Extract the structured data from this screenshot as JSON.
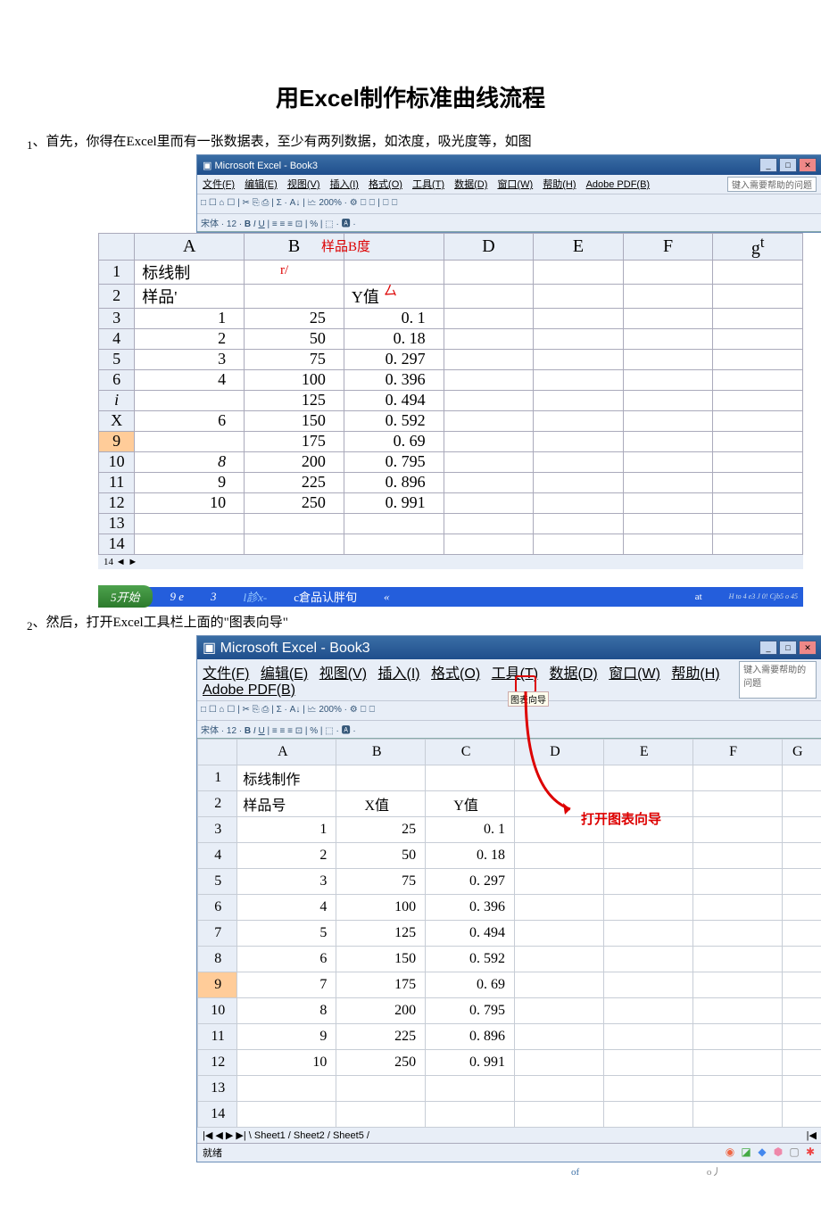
{
  "title": "用Excel制作标准曲线流程",
  "step1": {
    "num": "1",
    "text": "、首先，你得在Excel里而有一张数据表，至少有两列数据，如浓度，吸光度等，如图"
  },
  "step2": {
    "num": "2",
    "text": "、然后，打开Excel工具栏上面的\"图表向导\""
  },
  "excel_window": {
    "title": "Microsoft Excel - Book3",
    "menus": [
      "文件(F)",
      "编辑(E)",
      "视图(V)",
      "插入(I)",
      "格式(O)",
      "工具(T)",
      "数据(D)",
      "窗口(W)",
      "帮助(H)",
      "Adobe PDF(B)"
    ],
    "help_placeholder": "键入需要帮助的问题",
    "win_subtitle": "- _ ☐ ✕",
    "font_label": "宋体",
    "font_size": "12",
    "zoom": "200%",
    "chart_wizard_tooltip": "图表向导"
  },
  "sheet1": {
    "col_headers": [
      "A",
      "B",
      "D",
      "E",
      "F"
    ],
    "g_sup": "g",
    "g_sup_t": "t",
    "red_overlay1": "样品B度",
    "red_overlay2": "r/",
    "red_overlay3": "厶",
    "row_headers": [
      "1",
      "2",
      "3",
      "4",
      "5",
      "6",
      "i",
      "X",
      "9",
      "10",
      "11",
      "12",
      "13",
      "14"
    ],
    "r1": "标线制",
    "r2a": "样品'",
    "r2c": "Y值",
    "data": [
      {
        "a": "1",
        "b": "25",
        "c": "0. 1"
      },
      {
        "a": "2",
        "b": "50",
        "c": "0. 18"
      },
      {
        "a": "3",
        "b": "75",
        "c": "0. 297"
      },
      {
        "a": "4",
        "b": "100",
        "c": "0. 396"
      },
      {
        "a": "",
        "b": "125",
        "c": "0. 494"
      },
      {
        "a": "6",
        "b": "150",
        "c": "0. 592"
      },
      {
        "a": "",
        "b": "175",
        "c": "0. 69"
      },
      {
        "a": "8",
        "b": "200",
        "c": "0. 795"
      },
      {
        "a": "9",
        "b": "225",
        "c": "0. 896"
      },
      {
        "a": "10",
        "b": "250",
        "c": "0. 991"
      }
    ],
    "tab_strip": "14 ◄ ►"
  },
  "taskbar1": {
    "start": "5开始",
    "items": [
      "9 e",
      "3",
      "l診x-",
      "c倉品认胖旬",
      "«"
    ],
    "at": "at",
    "tray": "H to 4 e3 J 0!\nCjb5 o 45"
  },
  "sheet2": {
    "col_headers": [
      "A",
      "B",
      "C",
      "D",
      "E",
      "F",
      "G"
    ],
    "row_headers": [
      "1",
      "2",
      "3",
      "4",
      "5",
      "6",
      "7",
      "8",
      "9",
      "10",
      "11",
      "12",
      "13",
      "14"
    ],
    "r1a": "标线制作",
    "r2": {
      "a": "样品号",
      "b": "X值",
      "c": "Y值"
    },
    "data": [
      {
        "a": "1",
        "b": "25",
        "c": "0. 1"
      },
      {
        "a": "2",
        "b": "50",
        "c": "0. 18"
      },
      {
        "a": "3",
        "b": "75",
        "c": "0. 297"
      },
      {
        "a": "4",
        "b": "100",
        "c": "0. 396"
      },
      {
        "a": "5",
        "b": "125",
        "c": "0. 494"
      },
      {
        "a": "6",
        "b": "150",
        "c": "0. 592"
      },
      {
        "a": "7",
        "b": "175",
        "c": "0. 69"
      },
      {
        "a": "8",
        "b": "200",
        "c": "0. 795"
      },
      {
        "a": "9",
        "b": "225",
        "c": "0. 896"
      },
      {
        "a": "10",
        "b": "250",
        "c": "0. 991"
      }
    ],
    "sheet_tabs": "Sheet1 / Sheet2 / Sheet5 /",
    "status": "就绪",
    "annotation": "打开图表向导"
  },
  "bottom_row": {
    "of": "of",
    "o": "o丿"
  },
  "chart_data": {
    "type": "line",
    "title": "标线制作",
    "xlabel": "X值",
    "ylabel": "Y值",
    "x": [
      25,
      50,
      75,
      100,
      125,
      150,
      175,
      200,
      225,
      250
    ],
    "y": [
      0.1,
      0.18,
      0.297,
      0.396,
      0.494,
      0.592,
      0.69,
      0.795,
      0.896,
      0.991
    ]
  }
}
